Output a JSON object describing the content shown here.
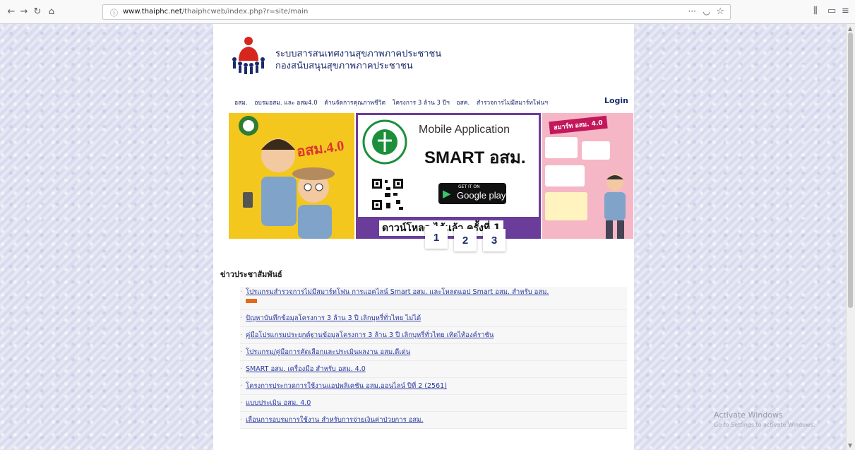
{
  "browser": {
    "url_domain": "www.thaiphc.net",
    "url_path": "/thaiphcweb/index.php?r=site/main"
  },
  "site": {
    "title_line1": "ระบบสารสนเทศงานสุขภาพภาคประชาชน",
    "title_line2": "กองสนับสนุนสุขภาพภาคประชาชน"
  },
  "menu": {
    "items": [
      "อสม.",
      "อบรมอสม. และ อสม4.0",
      "ด้านจัดการคุณภาพชีวิต",
      "โครงการ 3 ล้าน 3 ปีฯ",
      "อสค.",
      "สำรวจการไม่มีสมาร์ทโฟนฯ"
    ],
    "login": "Login"
  },
  "banner": {
    "left_text": "อสม.4.0",
    "app_title": "Mobile Application",
    "app_name": "SMART อสม.",
    "get_it_on": "GET IT ON",
    "store": "Google play",
    "footer": "ดาวน์โหลด ได้แล้ว ครั้งที่ 1",
    "right_title": "สมาร์ท อสม. 4.0",
    "pages": [
      "1",
      "2",
      "3"
    ]
  },
  "news": {
    "heading": "ข่าวประชาสัมพันธ์",
    "items": [
      "โปรแกรมสำรวจการไม่มีสมาร์ทโฟน การแอคไลน์ Smart อสม. และโหลดแอป Smart อสม. สำหรับ อสม.",
      "ปัญหาบันทึกข้อมูลโครงการ 3 ล้าน 3 ปี เลิกบุหรี่ทั่วไทย ไม่ได้",
      "คู่มือโปรแกรมประยุกต์ฐานข้อมูลโครงการ 3 ล้าน 3 ปี เลิกบุหรี่ทั่วไทย เทิดไท้องค์ราชัน",
      "โปรแกรม/คู่มือการคัดเลือกและประเมินผลงาน อสม.ดีเด่น",
      "SMART อสม. เครื่องมือ สำหรับ อสม. 4.0",
      "โครงการประกวดการใช้งานแอปพลิเคชัน อสม.ออนไลน์ ปีที่ 2 (2561)",
      "แบบประเมิน อสม. 4.0",
      "เลื่อนการอบรมการใช้งาน สำหรับการจ่ายเงินค่าป่วยการ อสม."
    ]
  },
  "watermark": {
    "line1": "Activate Windows",
    "line2": "Go to Settings to activate Windows."
  },
  "colors": {
    "brand": "#1b2a6b",
    "link": "#2a3aa0",
    "banner_purple": "#6a3d9a",
    "banner_yellow": "#f4c71e"
  }
}
